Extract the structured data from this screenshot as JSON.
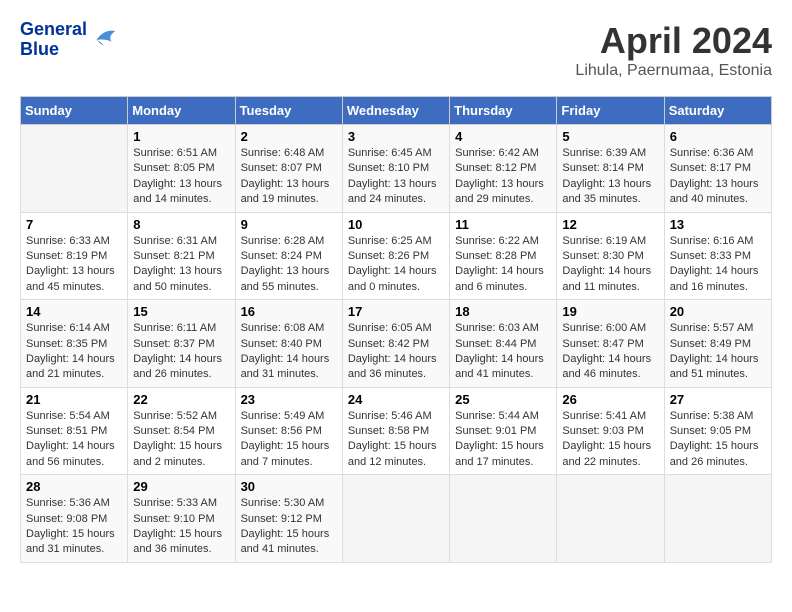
{
  "header": {
    "logo_general": "General",
    "logo_blue": "Blue",
    "title": "April 2024",
    "subtitle": "Lihula, Paernumaa, Estonia"
  },
  "calendar": {
    "days_of_week": [
      "Sunday",
      "Monday",
      "Tuesday",
      "Wednesday",
      "Thursday",
      "Friday",
      "Saturday"
    ],
    "weeks": [
      [
        {
          "day": "",
          "info": ""
        },
        {
          "day": "1",
          "info": "Sunrise: 6:51 AM\nSunset: 8:05 PM\nDaylight: 13 hours\nand 14 minutes."
        },
        {
          "day": "2",
          "info": "Sunrise: 6:48 AM\nSunset: 8:07 PM\nDaylight: 13 hours\nand 19 minutes."
        },
        {
          "day": "3",
          "info": "Sunrise: 6:45 AM\nSunset: 8:10 PM\nDaylight: 13 hours\nand 24 minutes."
        },
        {
          "day": "4",
          "info": "Sunrise: 6:42 AM\nSunset: 8:12 PM\nDaylight: 13 hours\nand 29 minutes."
        },
        {
          "day": "5",
          "info": "Sunrise: 6:39 AM\nSunset: 8:14 PM\nDaylight: 13 hours\nand 35 minutes."
        },
        {
          "day": "6",
          "info": "Sunrise: 6:36 AM\nSunset: 8:17 PM\nDaylight: 13 hours\nand 40 minutes."
        }
      ],
      [
        {
          "day": "7",
          "info": "Sunrise: 6:33 AM\nSunset: 8:19 PM\nDaylight: 13 hours\nand 45 minutes."
        },
        {
          "day": "8",
          "info": "Sunrise: 6:31 AM\nSunset: 8:21 PM\nDaylight: 13 hours\nand 50 minutes."
        },
        {
          "day": "9",
          "info": "Sunrise: 6:28 AM\nSunset: 8:24 PM\nDaylight: 13 hours\nand 55 minutes."
        },
        {
          "day": "10",
          "info": "Sunrise: 6:25 AM\nSunset: 8:26 PM\nDaylight: 14 hours\nand 0 minutes."
        },
        {
          "day": "11",
          "info": "Sunrise: 6:22 AM\nSunset: 8:28 PM\nDaylight: 14 hours\nand 6 minutes."
        },
        {
          "day": "12",
          "info": "Sunrise: 6:19 AM\nSunset: 8:30 PM\nDaylight: 14 hours\nand 11 minutes."
        },
        {
          "day": "13",
          "info": "Sunrise: 6:16 AM\nSunset: 8:33 PM\nDaylight: 14 hours\nand 16 minutes."
        }
      ],
      [
        {
          "day": "14",
          "info": "Sunrise: 6:14 AM\nSunset: 8:35 PM\nDaylight: 14 hours\nand 21 minutes."
        },
        {
          "day": "15",
          "info": "Sunrise: 6:11 AM\nSunset: 8:37 PM\nDaylight: 14 hours\nand 26 minutes."
        },
        {
          "day": "16",
          "info": "Sunrise: 6:08 AM\nSunset: 8:40 PM\nDaylight: 14 hours\nand 31 minutes."
        },
        {
          "day": "17",
          "info": "Sunrise: 6:05 AM\nSunset: 8:42 PM\nDaylight: 14 hours\nand 36 minutes."
        },
        {
          "day": "18",
          "info": "Sunrise: 6:03 AM\nSunset: 8:44 PM\nDaylight: 14 hours\nand 41 minutes."
        },
        {
          "day": "19",
          "info": "Sunrise: 6:00 AM\nSunset: 8:47 PM\nDaylight: 14 hours\nand 46 minutes."
        },
        {
          "day": "20",
          "info": "Sunrise: 5:57 AM\nSunset: 8:49 PM\nDaylight: 14 hours\nand 51 minutes."
        }
      ],
      [
        {
          "day": "21",
          "info": "Sunrise: 5:54 AM\nSunset: 8:51 PM\nDaylight: 14 hours\nand 56 minutes."
        },
        {
          "day": "22",
          "info": "Sunrise: 5:52 AM\nSunset: 8:54 PM\nDaylight: 15 hours\nand 2 minutes."
        },
        {
          "day": "23",
          "info": "Sunrise: 5:49 AM\nSunset: 8:56 PM\nDaylight: 15 hours\nand 7 minutes."
        },
        {
          "day": "24",
          "info": "Sunrise: 5:46 AM\nSunset: 8:58 PM\nDaylight: 15 hours\nand 12 minutes."
        },
        {
          "day": "25",
          "info": "Sunrise: 5:44 AM\nSunset: 9:01 PM\nDaylight: 15 hours\nand 17 minutes."
        },
        {
          "day": "26",
          "info": "Sunrise: 5:41 AM\nSunset: 9:03 PM\nDaylight: 15 hours\nand 22 minutes."
        },
        {
          "day": "27",
          "info": "Sunrise: 5:38 AM\nSunset: 9:05 PM\nDaylight: 15 hours\nand 26 minutes."
        }
      ],
      [
        {
          "day": "28",
          "info": "Sunrise: 5:36 AM\nSunset: 9:08 PM\nDaylight: 15 hours\nand 31 minutes."
        },
        {
          "day": "29",
          "info": "Sunrise: 5:33 AM\nSunset: 9:10 PM\nDaylight: 15 hours\nand 36 minutes."
        },
        {
          "day": "30",
          "info": "Sunrise: 5:30 AM\nSunset: 9:12 PM\nDaylight: 15 hours\nand 41 minutes."
        },
        {
          "day": "",
          "info": ""
        },
        {
          "day": "",
          "info": ""
        },
        {
          "day": "",
          "info": ""
        },
        {
          "day": "",
          "info": ""
        }
      ]
    ]
  }
}
